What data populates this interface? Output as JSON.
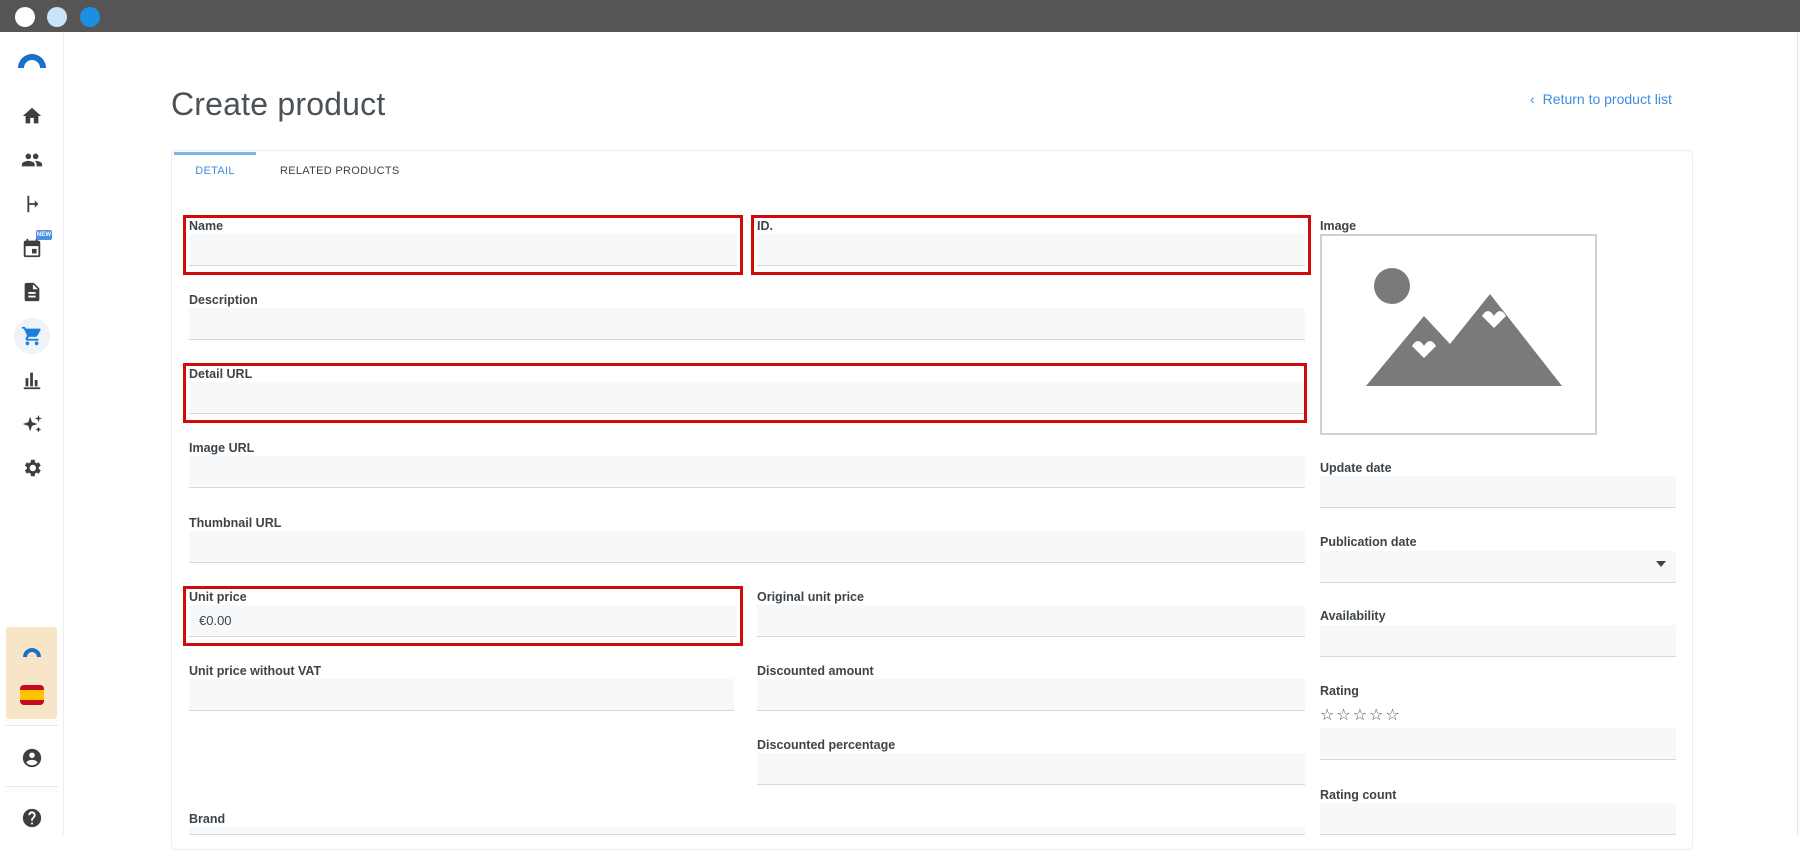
{
  "app": {
    "window_dots": [
      "close",
      "minimize",
      "maximize"
    ]
  },
  "sidebar": {
    "items": [
      {
        "name": "home-icon"
      },
      {
        "name": "users-icon"
      },
      {
        "name": "branch-icon"
      },
      {
        "name": "calendar-icon",
        "badge": "NEW"
      },
      {
        "name": "document-icon"
      },
      {
        "name": "cart-icon",
        "active": true
      },
      {
        "name": "bar-chart-icon"
      },
      {
        "name": "sparkle-icon"
      },
      {
        "name": "gear-icon"
      }
    ],
    "bottom_items": [
      {
        "name": "account-icon"
      },
      {
        "name": "help-icon"
      }
    ],
    "accent_color": "#1c7fd8"
  },
  "header": {
    "title": "Create product",
    "return_link": "Return to product list"
  },
  "tabs": [
    {
      "label": "DETAIL",
      "active": true
    },
    {
      "label": "RELATED PRODUCTS",
      "active": false
    }
  ],
  "form": {
    "name": {
      "label": "Name",
      "value": ""
    },
    "id": {
      "label": "ID.",
      "value": ""
    },
    "description": {
      "label": "Description",
      "value": ""
    },
    "detail_url": {
      "label": "Detail URL",
      "value": ""
    },
    "image_url": {
      "label": "Image URL",
      "value": ""
    },
    "thumbnail_url": {
      "label": "Thumbnail URL",
      "value": ""
    },
    "unit_price": {
      "label": "Unit price",
      "value": "€0.00"
    },
    "original_unit_price": {
      "label": "Original unit price",
      "value": ""
    },
    "unit_price_without_vat": {
      "label": "Unit price without VAT",
      "value": ""
    },
    "discounted_amount": {
      "label": "Discounted amount",
      "value": ""
    },
    "discounted_percentage": {
      "label": "Discounted percentage",
      "value": ""
    },
    "brand": {
      "label": "Brand",
      "value": ""
    },
    "image": {
      "label": "Image"
    },
    "update_date": {
      "label": "Update date",
      "value": ""
    },
    "publication_date": {
      "label": "Publication date",
      "value": ""
    },
    "availability": {
      "label": "Availability",
      "value": ""
    },
    "rating": {
      "label": "Rating",
      "stars": "☆☆☆☆☆",
      "value": ""
    },
    "rating_count": {
      "label": "Rating count",
      "value": ""
    }
  },
  "highlight_color": "#d00b0b"
}
